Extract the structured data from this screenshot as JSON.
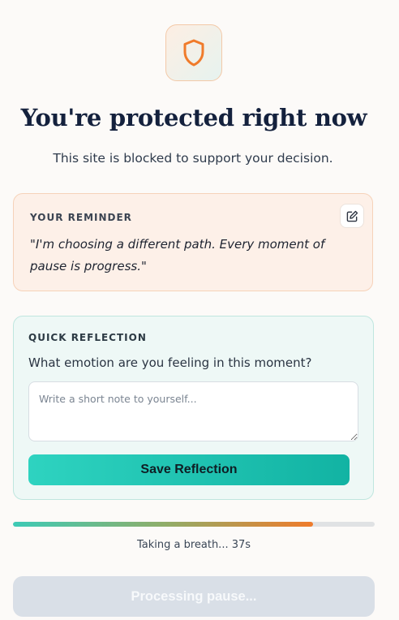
{
  "header": {
    "icon": "shield-icon",
    "title": "You're protected right now",
    "subtitle": "This site is blocked to support your decision."
  },
  "reminder": {
    "label": "YOUR REMINDER",
    "quote": "\"I'm choosing a different path. Every moment of pause is progress.\"",
    "edit_icon": "edit-icon"
  },
  "reflection": {
    "label": "QUICK REFLECTION",
    "question": "What emotion are you feeling in this moment?",
    "note_value": "",
    "note_placeholder": "Write a short note to yourself...",
    "save_label": "Save Reflection"
  },
  "timer": {
    "progress_percent": 83,
    "text": "Taking a breath... 37s"
  },
  "processing_button": {
    "label": "Processing pause...",
    "disabled": true
  },
  "colors": {
    "accent_orange": "#f07b2b",
    "accent_teal": "#14b8a6",
    "title": "#14213d"
  }
}
